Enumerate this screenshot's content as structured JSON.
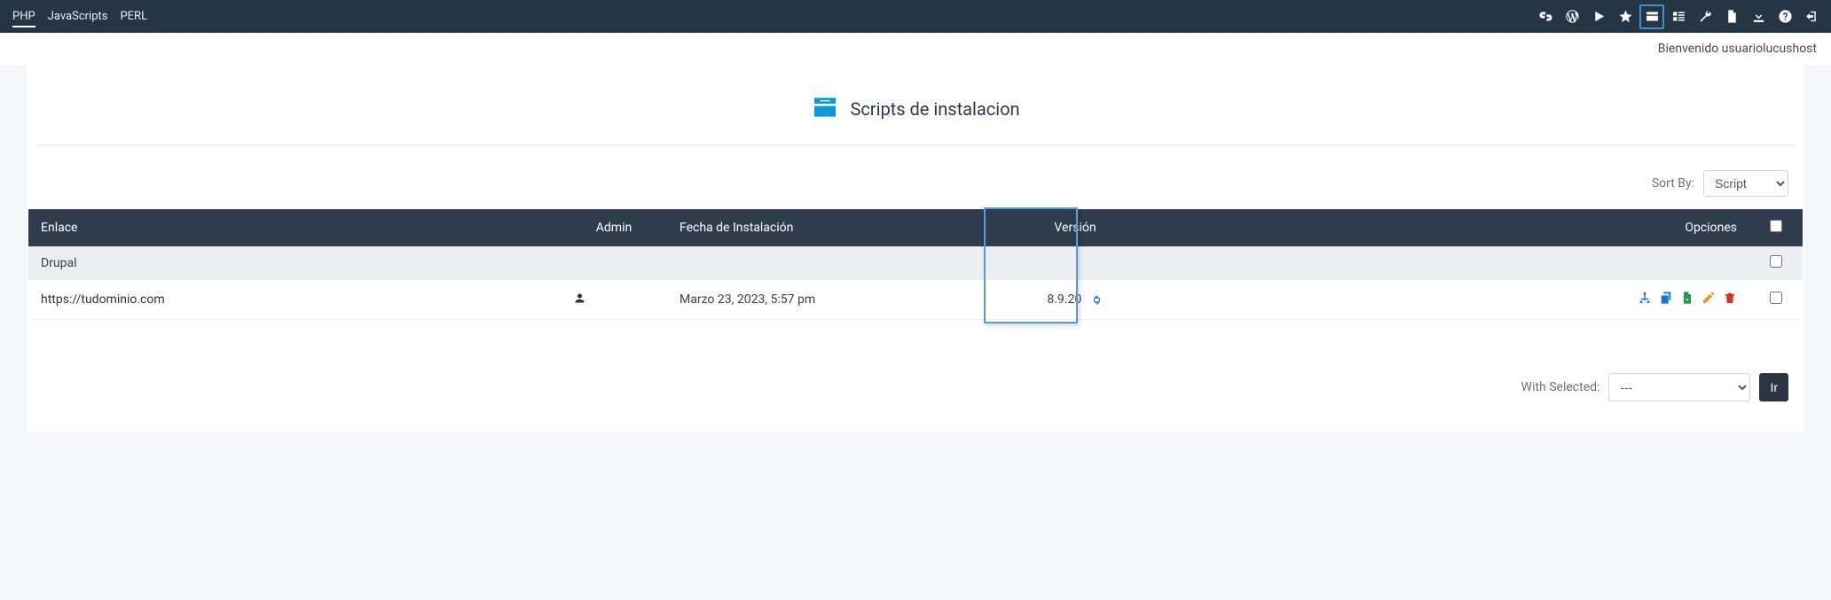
{
  "topTabs": {
    "php": "PHP",
    "js": "JavaScripts",
    "perl": "PERL"
  },
  "welcome": "Bienvenido usuariolucushost",
  "page": {
    "title": "Scripts de instalacion"
  },
  "sort": {
    "label": "Sort By:",
    "selected": "Script"
  },
  "table": {
    "headers": {
      "link": "Enlace",
      "admin": "Admin",
      "installDate": "Fecha de Instalación",
      "version": "Versión",
      "options": "Opciones"
    },
    "group": "Drupal",
    "row": {
      "link": "https://tudominio.com",
      "date": "Marzo 23, 2023, 5:57 pm",
      "version": "8.9.20"
    }
  },
  "withSelected": {
    "label": "With Selected:",
    "selected": "---",
    "go": "Ir"
  }
}
